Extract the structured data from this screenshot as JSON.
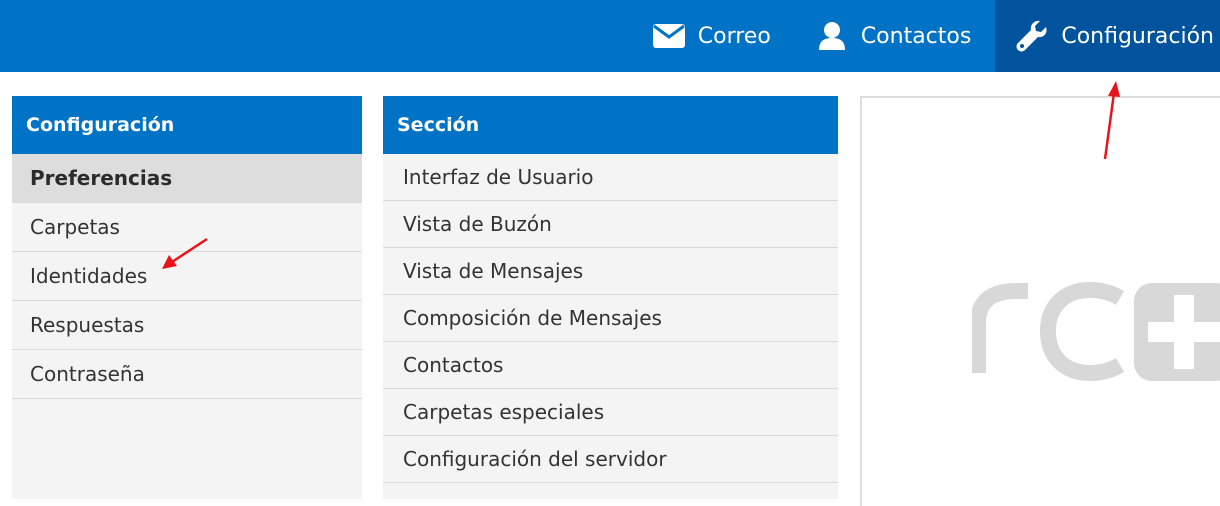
{
  "nav": {
    "items": [
      {
        "label": "Correo",
        "icon": "envelope-icon"
      },
      {
        "label": "Contactos",
        "icon": "person-icon"
      },
      {
        "label": "Configuración",
        "icon": "wrench-icon",
        "active": true
      }
    ]
  },
  "config_panel": {
    "title": "Configuración",
    "items": [
      "Preferencias",
      "Carpetas",
      "Identidades",
      "Respuestas",
      "Contraseña"
    ],
    "selected": "Preferencias"
  },
  "section_panel": {
    "title": "Sección",
    "items": [
      "Interfaz de Usuario",
      "Vista de Buzón",
      "Vista de Mensajes",
      "Composición de Mensajes",
      "Contactos",
      "Carpetas especiales",
      "Configuración del servidor"
    ]
  },
  "colors": {
    "header_bg": "#0073c6",
    "active_nav_bg": "#00539c",
    "annotation_arrow": "#e8141a",
    "watermark": "#d8d8d8"
  }
}
